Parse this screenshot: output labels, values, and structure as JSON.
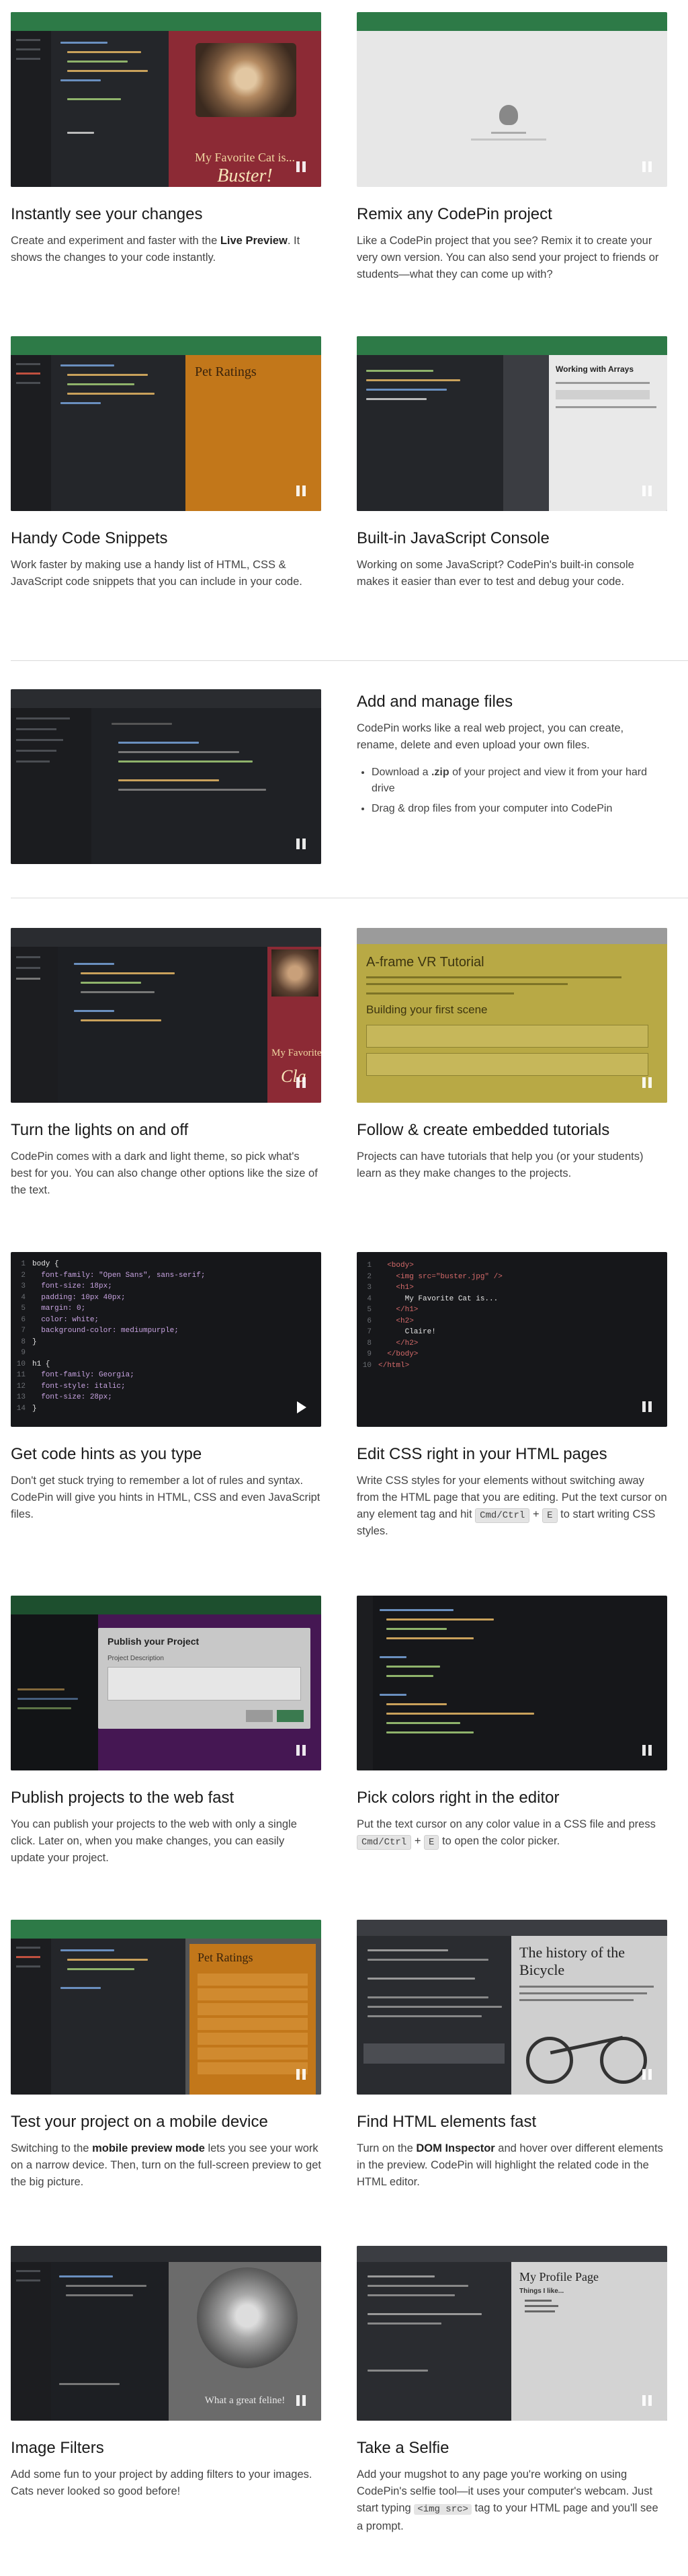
{
  "features": [
    {
      "title": "Instantly see your changes",
      "desc_before": "Create and experiment and faster with the ",
      "desc_bold": "Live Preview",
      "desc_after": ". It shows the changes to your code instantly.",
      "preview_heading": "My Favorite Cat is...",
      "preview_name": "Buster!"
    },
    {
      "title": "Remix any CodePin project",
      "desc": "Like a CodePin project that you see? Remix it to create your very own version. You can also send your project to friends or students—what they can come up with?"
    },
    {
      "title": "Handy Code Snippets",
      "desc": "Work faster by making use a handy list of HTML, CSS & JavaScript code snippets that you can include in your code.",
      "preview_heading": "Pet Ratings"
    },
    {
      "title": "Built-in JavaScript Console",
      "desc": "Working on some JavaScript? CodePin's built-in console makes it easier than ever to test and debug your code.",
      "preview_heading": "Working with Arrays"
    },
    {
      "title": "Add and manage files",
      "desc": "CodePin works like a real web project, you can create, rename, delete and even upload your own files.",
      "bullet1_before": "Download a ",
      "bullet1_bold": ".zip",
      "bullet1_after": " of your project and view it from your hard drive",
      "bullet2": "Drag & drop files from your computer into CodePin"
    },
    {
      "title": "Turn the lights on and off",
      "desc": "CodePin comes with a dark and light theme, so pick what's best for you. You can also change other options like the size of the text.",
      "preview_heading": "My Favorite Cat is...",
      "preview_name": "Cla"
    },
    {
      "title": "Follow & create embedded tutorials",
      "desc": "Projects can have tutorials that help you (or your students) learn as they make changes to the projects.",
      "preview_heading": "A-frame VR Tutorial",
      "preview_subheading": "Building your first scene"
    },
    {
      "title": "Get code hints as you type",
      "desc": "Don't get stuck trying to remember a lot of rules and syntax. CodePin will give you hints in HTML, CSS and even JavaScript files."
    },
    {
      "title": "Edit CSS right in your HTML pages",
      "desc_before": "Write CSS styles for your elements without switching away from the HTML page that you are editing. Put the text cursor on any element tag and hit ",
      "key1": "Cmd/Ctrl",
      "plus": "+",
      "key2": "E",
      "desc_after": " to start writing CSS styles."
    },
    {
      "title": "Publish projects to the web fast",
      "desc": "You can publish your projects to the web with only a single click. Later on, when you make changes, you can easily update your project.",
      "dialog_title": "Publish your Project",
      "dialog_label": "Project Description"
    },
    {
      "title": "Pick colors right in the editor",
      "desc_before": "Put the text cursor on any color value in a CSS file and press ",
      "key1": "Cmd/Ctrl",
      "plus": "+",
      "key2": "E",
      "desc_after": " to open the color picker."
    },
    {
      "title": "Test your project on a mobile device",
      "desc_before": "Switching to the ",
      "desc_bold": "mobile preview mode",
      "desc_after": " lets you see your work on a narrow device. Then, turn on the full-screen preview to get the big picture.",
      "preview_heading": "Pet Ratings"
    },
    {
      "title": "Find HTML elements fast",
      "desc_before": "Turn on the ",
      "desc_bold": "DOM Inspector",
      "desc_after": " and hover over different elements in the preview. CodePin will highlight the related code in the HTML editor.",
      "preview_heading": "The history of the Bicycle"
    },
    {
      "title": "Image Filters",
      "desc": "Add some fun to your project by adding filters to your images. Cats never looked so good before!",
      "preview_caption": "What a great feline!"
    },
    {
      "title": "Take a Selfie",
      "desc_before": "Add your mugshot to any page you're working on using CodePin's selfie tool—it uses your computer's webcam. Just start typing ",
      "code": "<img src>",
      "desc_after": " tag to your HTML page and you'll see a prompt.",
      "preview_heading": "My Profile Page",
      "preview_sub": "Things I like..."
    }
  ],
  "code_hints": {
    "lines": [
      "body {",
      "  font-family: \"Open Sans\", sans-serif;",
      "  font-size: 18px;",
      "  padding: 10px 40px;",
      "  margin: 0;",
      "  color: white;",
      "  background-color: mediumpurple;",
      "}",
      "",
      "h1 {",
      "  font-family: Georgia;",
      "  font-style: italic;",
      "  font-size: 28px;",
      "}"
    ]
  },
  "css_in_html": {
    "lines": [
      "  <body>",
      "    <img src=\"buster.jpg\" />",
      "    <h1>",
      "      My Favorite Cat is...",
      "    </h1>",
      "    <h2>",
      "      Claire!",
      "    </h2>",
      "  </body>",
      "</html>"
    ]
  },
  "colors": {
    "brand_green": "#2d7a47",
    "editor_bg": "#1f2125",
    "cat_red": "#8c2a35",
    "orange_preview": "#c2771a",
    "purple_preview": "#6a2480",
    "tutorial_olive": "#b4a643"
  }
}
